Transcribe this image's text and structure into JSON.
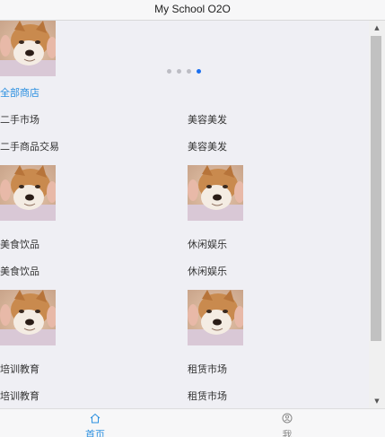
{
  "navbar": {
    "title": "My School O2O"
  },
  "carousel": {
    "slide_count": 4,
    "active_index": 3
  },
  "section": {
    "title": "全部商店"
  },
  "categories": [
    {
      "name": "二手市场",
      "subtitle": "二手商品交易",
      "has_image": false
    },
    {
      "name": "美容美发",
      "subtitle": "美容美发",
      "has_image": true
    },
    {
      "name": "美食饮品",
      "subtitle": "美食饮品",
      "has_image": true
    },
    {
      "name": "休闲娱乐",
      "subtitle": "休闲娱乐",
      "has_image": true
    },
    {
      "name": "培训教育",
      "subtitle": "培训教育",
      "has_image": true
    },
    {
      "name": "租赁市场",
      "subtitle": "租赁市场",
      "has_image": true
    }
  ],
  "tabbar": {
    "home": {
      "label": "首页",
      "icon": "home-icon",
      "active": true
    },
    "me": {
      "label": "我",
      "icon": "user-icon",
      "active": false
    }
  },
  "colors": {
    "accent": "#2a8fe0",
    "active_dot": "#1a6ff0",
    "background": "#efeff4"
  }
}
